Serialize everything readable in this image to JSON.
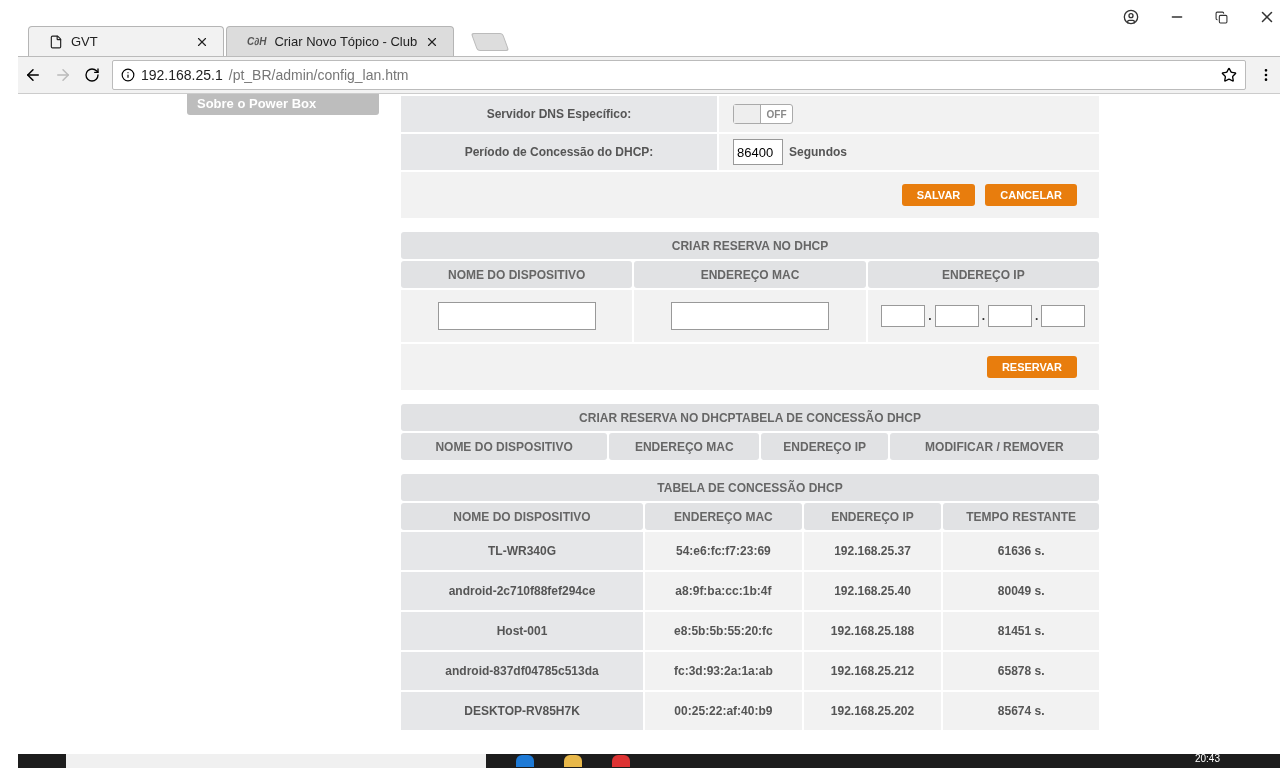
{
  "browser": {
    "tabs": [
      {
        "title": "GVT",
        "selected": true,
        "kind": "page"
      },
      {
        "title": "Criar Novo Tópico - Club",
        "selected": false,
        "kind": "site"
      }
    ],
    "site_logo": "C∂H",
    "address": {
      "host": "192.168.25.1",
      "path": "/pt_BR/admin/config_lan.htm"
    }
  },
  "sidebar": {
    "items": [
      {
        "label": "Sobre o Power Box"
      }
    ]
  },
  "lan_form": {
    "rows": [
      {
        "label": "Servidor DNS Específico:",
        "kind": "toggle",
        "on": false,
        "toggle_text": "OFF"
      },
      {
        "label": "Período de Concessão do DHCP:",
        "kind": "input",
        "value": "86400",
        "unit": "Segundos"
      }
    ],
    "buttons": [
      "SALVAR",
      "CANCELAR"
    ]
  },
  "reserve": {
    "title": "CRIAR RESERVA NO DHCP",
    "columns": [
      "NOME DO DISPOSITIVO",
      "ENDEREÇO MAC",
      "ENDEREÇO IP"
    ],
    "ip_separator": ".",
    "button": "RESERVAR"
  },
  "reservations": {
    "title": "CRIAR RESERVA NO DHCPTABELA DE CONCESSÃO DHCP",
    "columns": [
      "NOME DO DISPOSITIVO",
      "ENDEREÇO MAC",
      "ENDEREÇO IP",
      "MODIFICAR / REMOVER"
    ]
  },
  "leases": {
    "title": "TABELA DE CONCESSÃO DHCP",
    "columns": [
      "NOME DO DISPOSITIVO",
      "ENDEREÇO MAC",
      "ENDEREÇO IP",
      "TEMPO RESTANTE"
    ],
    "rows": [
      [
        "TL-WR340G",
        "54:e6:fc:f7:23:69",
        "192.168.25.37",
        "61636 s."
      ],
      [
        "android-2c710f88fef294ce",
        "a8:9f:ba:cc:1b:4f",
        "192.168.25.40",
        "80049 s."
      ],
      [
        "Host-001",
        "e8:5b:5b:55:20:fc",
        "192.168.25.188",
        "81451 s."
      ],
      [
        "android-837df04785c513da",
        "fc:3d:93:2a:1a:ab",
        "192.168.25.212",
        "65878 s."
      ],
      [
        "DESKTOP-RV85H7K",
        "00:25:22:af:40:b9",
        "192.168.25.202",
        "85674 s."
      ]
    ]
  },
  "taskbar": {
    "clock": "20:43"
  }
}
